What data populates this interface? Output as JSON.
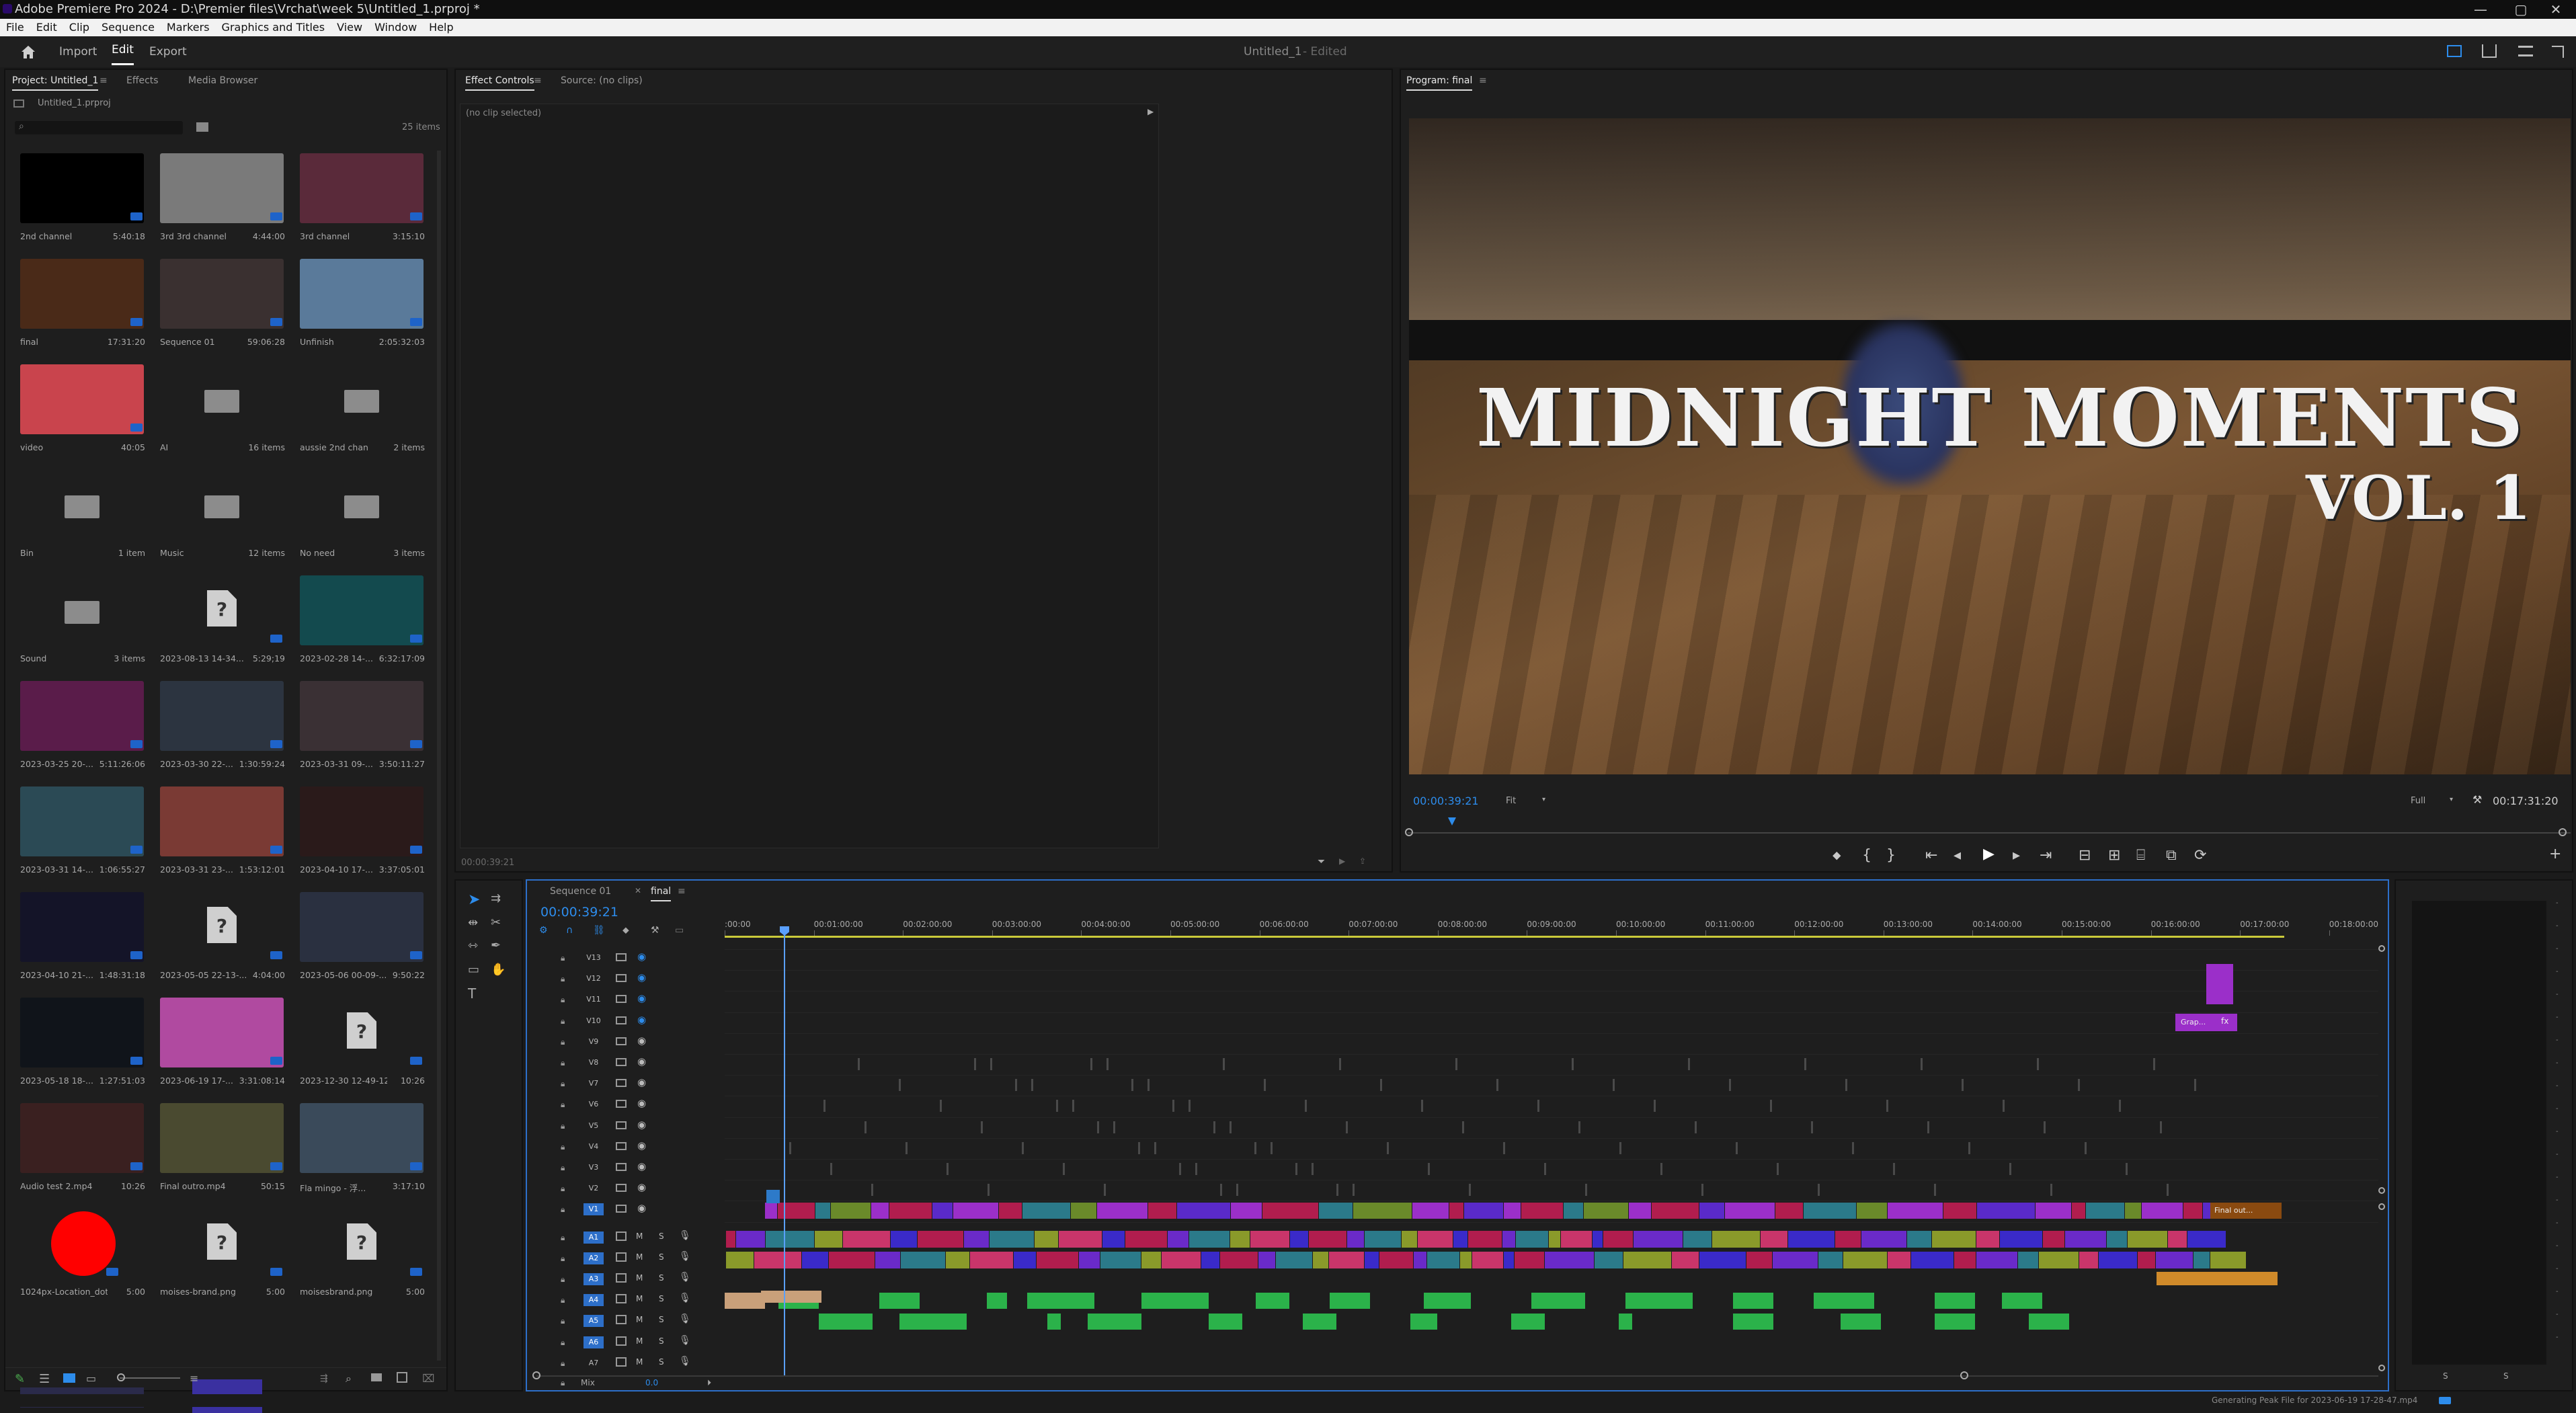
{
  "app": {
    "title": "Adobe Premiere Pro 2024 - D:\\Premier files\\Vrchat\\week 5\\Untitled_1.prproj *",
    "window_controls": [
      "—",
      "▢",
      "✕"
    ]
  },
  "menu": [
    "File",
    "Edit",
    "Clip",
    "Sequence",
    "Markers",
    "Graphics and Titles",
    "View",
    "Window",
    "Help"
  ],
  "header": {
    "nav": [
      "Import",
      "Edit",
      "Export"
    ],
    "active": "Edit",
    "project_name": "Untitled_1",
    "edited": "- Edited"
  },
  "project_panel": {
    "tabs": [
      "Project: Untitled_1",
      "Effects",
      "Media Browser"
    ],
    "path": "Untitled_1.prproj",
    "items_count": "25 items",
    "items": [
      {
        "name": "2nd channel",
        "meta": "5:40:18",
        "kind": "video",
        "color": "#000000"
      },
      {
        "name": "3rd 3rd channel",
        "meta": "4:44:00",
        "kind": "video",
        "color": "#7a7a7a"
      },
      {
        "name": "3rd channel",
        "meta": "3:15:10",
        "kind": "video",
        "color": "#5a2a3a"
      },
      {
        "name": "final",
        "meta": "17:31:20",
        "kind": "video",
        "color": "#4a2a18"
      },
      {
        "name": "Sequence 01",
        "meta": "59:06:28",
        "kind": "video",
        "color": "#3a3030"
      },
      {
        "name": "Unfinish",
        "meta": "2:05:32:03",
        "kind": "video",
        "color": "#5a7a9a"
      },
      {
        "name": "video",
        "meta": "40:05",
        "kind": "video",
        "color": "#c9444d"
      },
      {
        "name": "AI",
        "meta": "16 items",
        "kind": "folder"
      },
      {
        "name": "aussie 2nd chan",
        "meta": "2 items",
        "kind": "folder"
      },
      {
        "name": "Bin",
        "meta": "1 item",
        "kind": "folder"
      },
      {
        "name": "Music",
        "meta": "12 items",
        "kind": "folder"
      },
      {
        "name": "No need",
        "meta": "3 items",
        "kind": "folder"
      },
      {
        "name": "Sound",
        "meta": "3 items",
        "kind": "folder"
      },
      {
        "name": "2023-08-13 14-34...",
        "meta": "5:29;19",
        "kind": "doc"
      },
      {
        "name": "2023-02-28 14-...",
        "meta": "6:32:17:09",
        "kind": "video",
        "color": "#134a4e"
      },
      {
        "name": "2023-03-25 20-...",
        "meta": "5:11:26:06",
        "kind": "video",
        "color": "#5a1c4a"
      },
      {
        "name": "2023-03-30 22-...",
        "meta": "1:30:59:24",
        "kind": "video",
        "color": "#2c3440"
      },
      {
        "name": "2023-03-31 09-...",
        "meta": "3:50:11:27",
        "kind": "video",
        "color": "#3a3034"
      },
      {
        "name": "2023-03-31 14-...",
        "meta": "1:06:55:27",
        "kind": "video",
        "color": "#2b4a55"
      },
      {
        "name": "2023-03-31 23-...",
        "meta": "1:53:12:01",
        "kind": "video",
        "color": "#7a3a34"
      },
      {
        "name": "2023-04-10 17-...",
        "meta": "3:37:05:01",
        "kind": "video",
        "color": "#2a1a1a"
      },
      {
        "name": "2023-04-10 21-...",
        "meta": "1:48:31:18",
        "kind": "video",
        "color": "#141428"
      },
      {
        "name": "2023-05-05 22-13-...",
        "meta": "4:04:00",
        "kind": "doc"
      },
      {
        "name": "2023-05-06 00-09-...",
        "meta": "9:50:22",
        "kind": "video",
        "color": "#2a3040"
      },
      {
        "name": "2023-05-18 18-...",
        "meta": "1:27:51:03",
        "kind": "video",
        "color": "#10141a"
      },
      {
        "name": "2023-06-19 17-...",
        "meta": "3:31:08:14",
        "kind": "video",
        "color": "#b04aa0"
      },
      {
        "name": "2023-12-30 12-49-12...",
        "meta": "10:26",
        "kind": "doc"
      },
      {
        "name": "Audio test 2.mp4",
        "meta": "10:26",
        "kind": "video",
        "color": "#3a2020"
      },
      {
        "name": "Final outro.mp4",
        "meta": "50:15",
        "kind": "video",
        "color": "#4a4a30"
      },
      {
        "name": "Fla mingo - 浮...",
        "meta": "3:17:10",
        "kind": "video",
        "color": "#3a4a5a"
      },
      {
        "name": "1024px-Location_dot...",
        "meta": "5:00",
        "kind": "reddot"
      },
      {
        "name": "moises-brand.png",
        "meta": "5:00",
        "kind": "doc"
      },
      {
        "name": "moisesbrand.png",
        "meta": "5:00",
        "kind": "doc"
      }
    ]
  },
  "effect_controls": {
    "tabs": [
      "Effect Controls",
      "Source: (no clips)"
    ],
    "empty": "(no clip selected)",
    "timecode": "00:00:39:21"
  },
  "program": {
    "tab": "Program: final",
    "title_line1": "MIDNIGHT MOMENTS",
    "title_line2": "VOL. 1",
    "timecode": "00:00:39:21",
    "fit": "Fit",
    "quality": "Full",
    "duration": "00:17:31:20"
  },
  "timeline": {
    "tabs": [
      "Sequence 01",
      "final"
    ],
    "active_tab": "final",
    "timecode": "00:00:39:21",
    "ruler": [
      ":00:00",
      "00:01:00:00",
      "00:02:00:00",
      "00:03:00:00",
      "00:04:00:00",
      "00:05:00:00",
      "00:06:00:00",
      "00:07:00:00",
      "00:08:00:00",
      "00:09:00:00",
      "00:10:00:00",
      "00:11:00:00",
      "00:12:00:00",
      "00:13:00:00",
      "00:14:00:00",
      "00:15:00:00",
      "00:16:00:00",
      "00:17:00:00",
      "00:18:00:00"
    ],
    "video_tracks": [
      "V13",
      "V12",
      "V11",
      "V10",
      "V9",
      "V8",
      "V7",
      "V6",
      "V5",
      "V4",
      "V3",
      "V2",
      "V1"
    ],
    "audio_tracks": [
      "A1",
      "A2",
      "A3",
      "A4",
      "A5",
      "A6",
      "A7"
    ],
    "mix_label": "Mix",
    "mix_value": "0.0",
    "clip_labels": {
      "graphic": "Grap...",
      "final_outro": "Final out...",
      "fx": "fx"
    }
  },
  "meters": {
    "labels": [
      "S",
      "S"
    ]
  },
  "status_bar": "Generating Peak File for 2023-06-19 17-28-47.mp4",
  "colors": {
    "accent": "#2d8ceb",
    "playhead": "#5aa0ff",
    "v1_clip": "#9b2fc9",
    "audio_clip": "#2bb24a"
  }
}
